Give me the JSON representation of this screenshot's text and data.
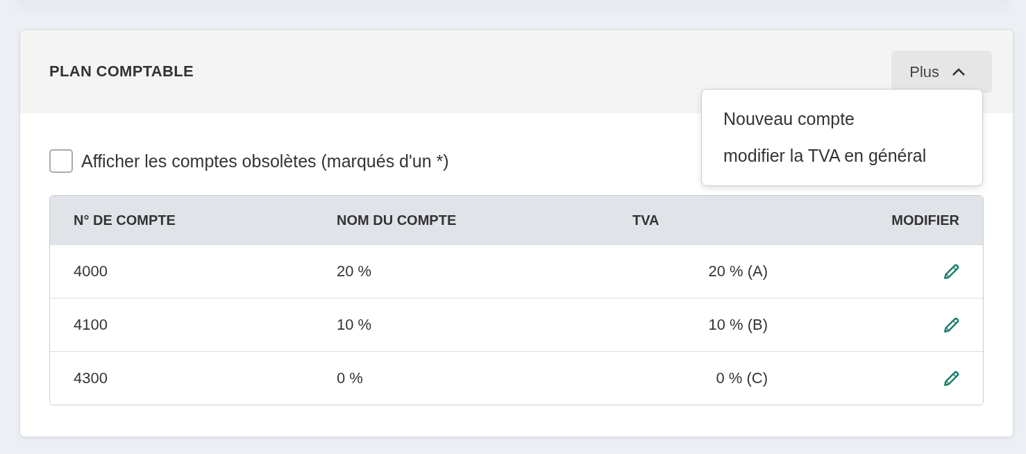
{
  "panel": {
    "title": "PLAN COMPTABLE",
    "menu_button": {
      "label": "Plus",
      "expanded": true
    },
    "menu_items": [
      {
        "label": "Nouveau compte"
      },
      {
        "label": "modifier la TVA en général"
      }
    ],
    "checkbox": {
      "label": "Afficher les comptes obsolètes (marqués d'un *)",
      "checked": false
    },
    "table": {
      "columns": [
        "N° DE COMPTE",
        "NOM DU COMPTE",
        "TVA",
        "MODIFIER"
      ],
      "rows": [
        {
          "number": "4000",
          "name": "20 %",
          "tva": "20 % (A)"
        },
        {
          "number": "4100",
          "name": "10 %",
          "tva": "10 % (B)"
        },
        {
          "number": "4300",
          "name": "0 %",
          "tva": "0 % (C)"
        }
      ]
    }
  }
}
